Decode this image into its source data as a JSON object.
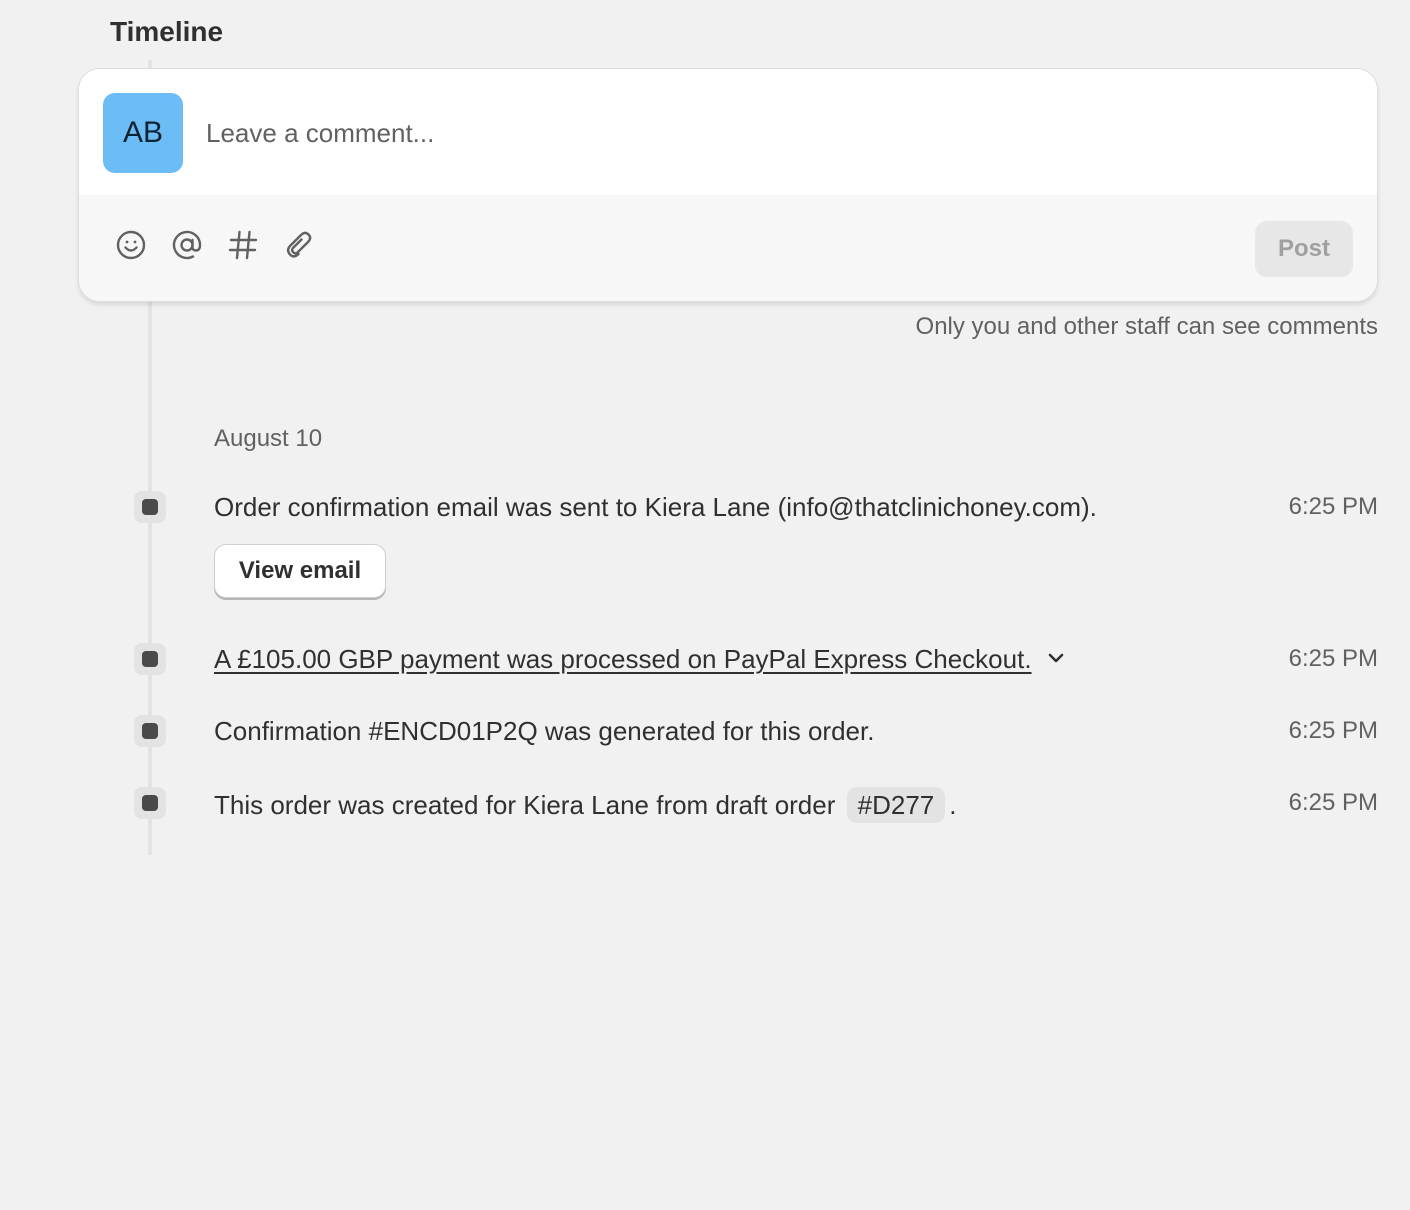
{
  "timeline": {
    "title": "Timeline"
  },
  "composer": {
    "avatar_initials": "AB",
    "avatar_color": "#6cbcf5",
    "placeholder": "Leave a comment...",
    "tools": [
      "emoji-icon",
      "mention-icon",
      "hashtag-icon",
      "attachment-icon"
    ],
    "post_label": "Post",
    "visibility_note": "Only you and other staff can see comments"
  },
  "events_group": {
    "date": "August 10",
    "events": [
      {
        "text": "Order confirmation email was sent to Kiera Lane (info@thatclinichoney.com).",
        "time": "6:25 PM",
        "action_label": "View email"
      },
      {
        "text": "A £105.00 GBP payment was processed on PayPal Express Checkout.",
        "time": "6:25 PM",
        "expand_icon": "chevron-down-icon"
      },
      {
        "text": "Confirmation #ENCD01P2Q was generated for this order.",
        "time": "6:25 PM"
      },
      {
        "text_before": "This order was created for Kiera Lane from draft order",
        "tag": "#D277",
        "text_after": ".",
        "time": "6:25 PM"
      }
    ]
  }
}
